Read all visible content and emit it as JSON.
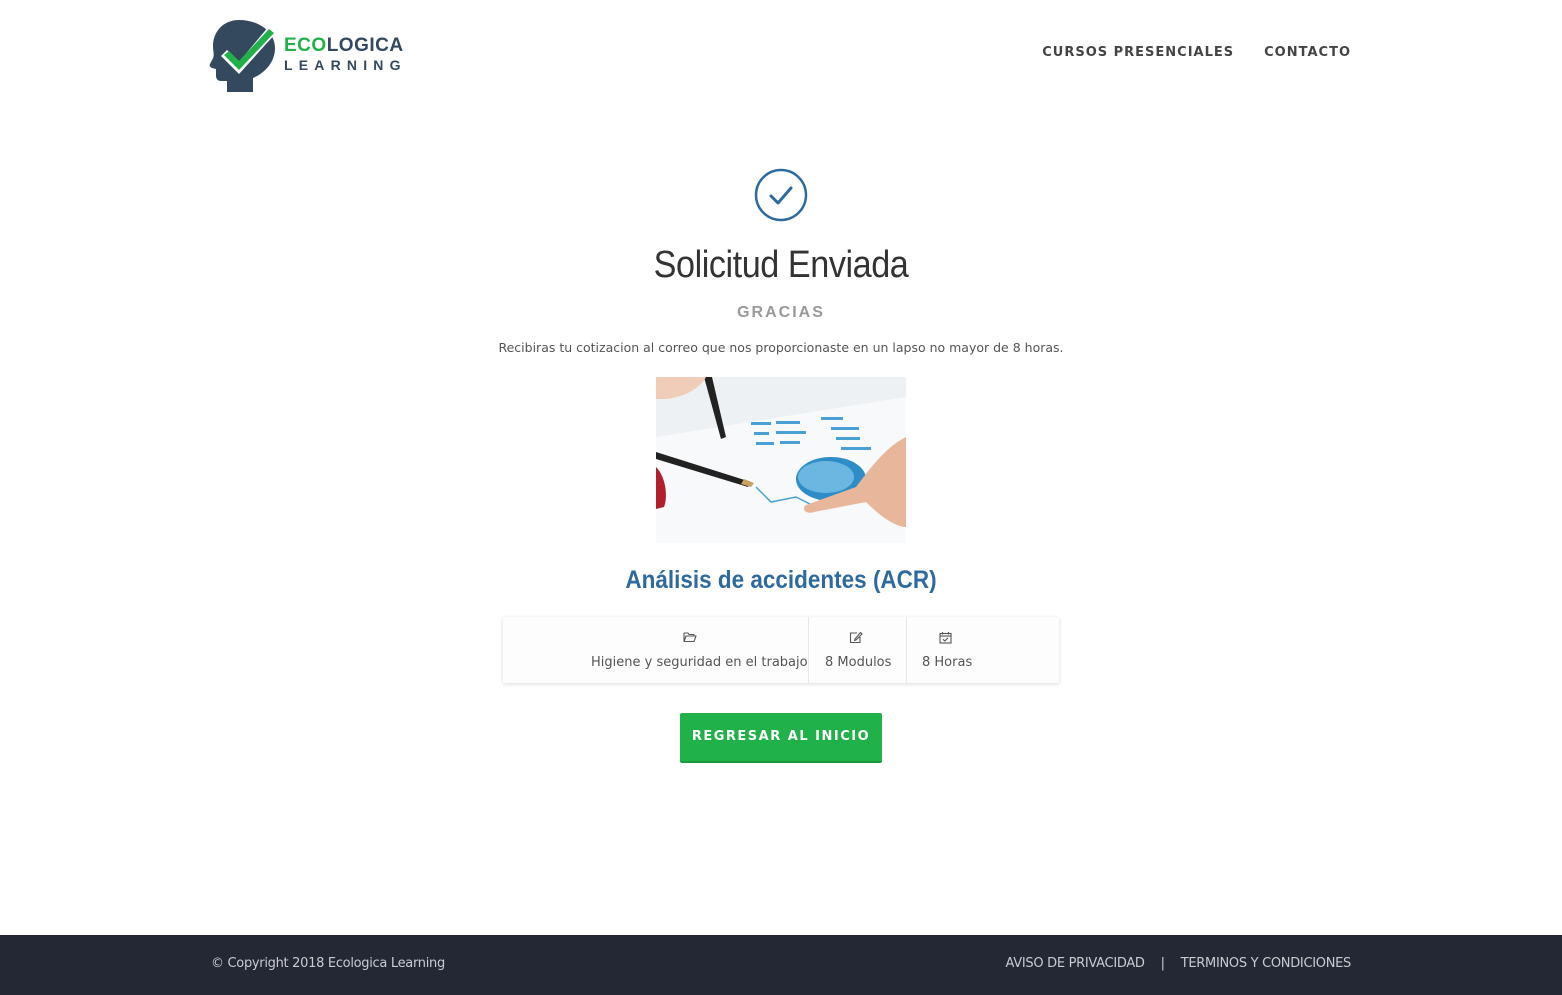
{
  "header": {
    "logo": {
      "line1_highlight": "ECO",
      "line1_rest": "LOGICA",
      "line2": "LEARNING"
    },
    "nav": [
      {
        "label": "CURSOS PRESENCIALES"
      },
      {
        "label": "CONTACTO"
      }
    ]
  },
  "main": {
    "title": "Solicitud Enviada",
    "subtitle": "GRACIAS",
    "message": "Recibiras tu cotizacion al correo que nos proporcionaste en un lapso no mayor de 8 horas.",
    "course": {
      "title": "Análisis de accidentes (ACR)",
      "category": "Higiene y seguridad en el trabajo",
      "modules": "8 Modulos",
      "hours": "8 Horas"
    },
    "button_label": "REGRESAR AL INICIO"
  },
  "footer": {
    "copyright": "© Copyright 2018 Ecologica Learning",
    "links": [
      {
        "label": "AVISO DE PRIVACIDAD"
      },
      {
        "label": "TERMINOS Y CONDICIONES"
      }
    ],
    "separator": "|"
  },
  "colors": {
    "brand_green": "#21b14b",
    "brand_navy": "#34495e",
    "accent_blue": "#2f6a9f",
    "footer_bg": "#232834"
  },
  "icons": {
    "success": "check-circle-icon",
    "category": "folder-open-icon",
    "modules": "edit-icon",
    "hours": "calendar-check-icon"
  }
}
